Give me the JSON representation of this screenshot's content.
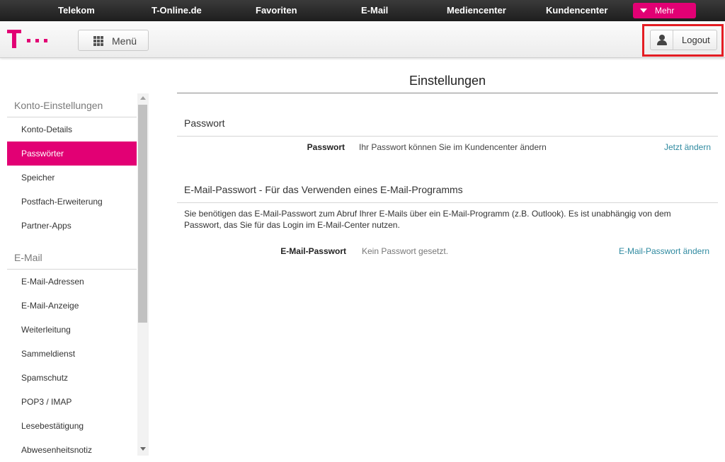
{
  "topnav": {
    "items": [
      "Telekom",
      "T-Online.de",
      "Favoriten",
      "E-Mail",
      "Mediencenter",
      "Kundencenter"
    ],
    "more_label": "Mehr"
  },
  "header": {
    "menu_label": "Menü",
    "logout_label": "Logout"
  },
  "sidebar": {
    "groups": [
      {
        "heading": "Konto-Einstellungen",
        "items": [
          "Konto-Details",
          "Passwörter",
          "Speicher",
          "Postfach-Erweiterung",
          "Partner-Apps"
        ]
      },
      {
        "heading": "E-Mail",
        "items": [
          "E-Mail-Adressen",
          "E-Mail-Anzeige",
          "Weiterleitung",
          "Sammeldienst",
          "Spamschutz",
          "POP3 / IMAP",
          "Lesebestätigung",
          "Abwesenheitsnotiz"
        ]
      }
    ],
    "active_item": "Passwörter"
  },
  "main": {
    "title": "Einstellungen",
    "sections": [
      {
        "heading": "Passwort",
        "label": "Passwort",
        "value": "Ihr Passwort können Sie im Kundencenter ändern",
        "action": "Jetzt ändern"
      },
      {
        "heading": "E-Mail-Passwort - Für das Verwenden eines E-Mail-Programms",
        "description": "Sie benötigen das E-Mail-Passwort zum Abruf Ihrer E-Mails über ein E-Mail-Programm (z.B. Outlook). Es ist unabhängig von dem Passwort, das Sie für das Login im E-Mail-Center nutzen.",
        "label": "E-Mail-Passwort",
        "value": "Kein Passwort gesetzt.",
        "action": "E-Mail-Passwort ändern"
      }
    ]
  },
  "colors": {
    "brand_magenta": "#e20074",
    "link_teal": "#2f8aa0",
    "highlight_red": "#e41d23"
  }
}
